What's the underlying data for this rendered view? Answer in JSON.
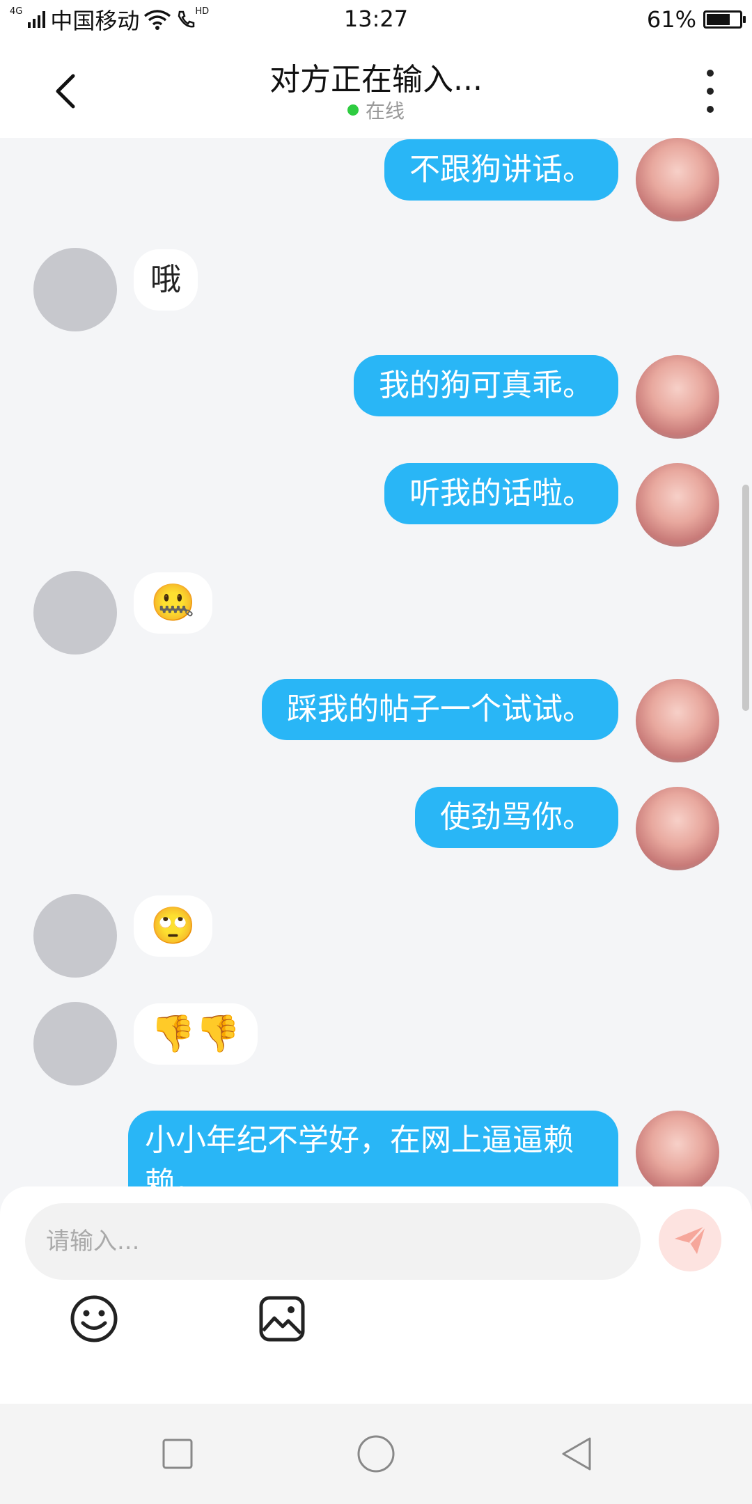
{
  "status_bar": {
    "network_type": "4G",
    "carrier": "中国移动",
    "hd": "HD",
    "time": "13:27",
    "battery_text": "61%",
    "battery_level": 0.61
  },
  "header": {
    "title": "对方正在输入...",
    "status": "在线",
    "status_color": "#2ecc40"
  },
  "messages": [
    {
      "side": "right",
      "text": "不跟狗讲话。"
    },
    {
      "side": "left",
      "text": "哦"
    },
    {
      "side": "right",
      "text": "我的狗可真乖。"
    },
    {
      "side": "right",
      "text": "听我的话啦。"
    },
    {
      "side": "left",
      "text": "🤐"
    },
    {
      "side": "right",
      "text": "踩我的帖子一个试试。"
    },
    {
      "side": "right",
      "text": "使劲骂你。"
    },
    {
      "side": "left",
      "text": "🙄"
    },
    {
      "side": "left",
      "text": "👎👎"
    },
    {
      "side": "right",
      "text": "小小年纪不学好，在网上逼逼赖赖。"
    }
  ],
  "input": {
    "placeholder": "请输入..."
  },
  "toolbar": {
    "emoji_icon": "smiley-face-icon",
    "image_icon": "image-picture-icon"
  },
  "colors": {
    "bubble_self": "#29b6f6",
    "bubble_other": "#ffffff",
    "send_button_bg": "#fde3e0",
    "send_icon": "#f6a79b"
  }
}
